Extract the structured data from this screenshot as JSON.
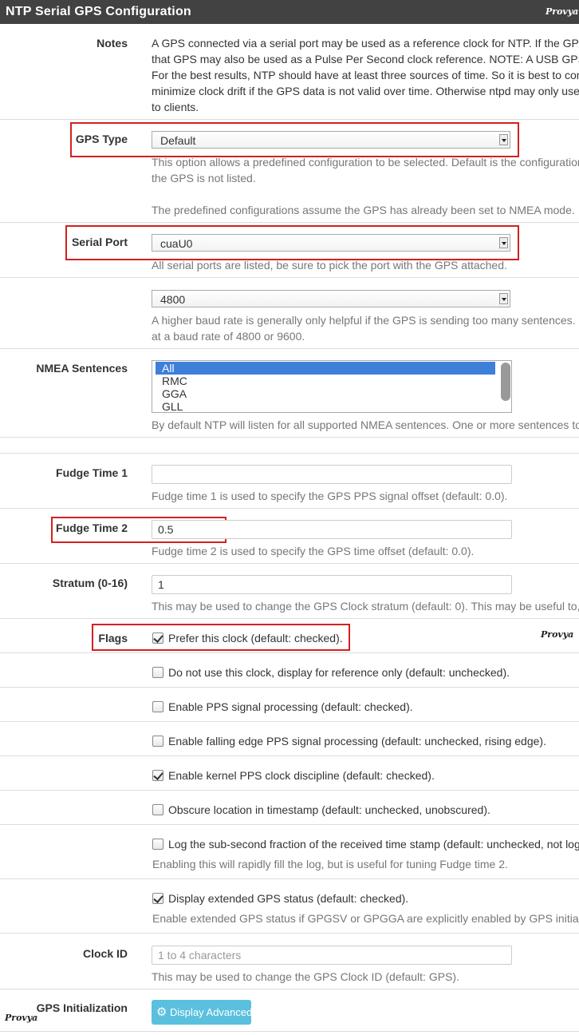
{
  "header": {
    "title": "NTP Serial GPS Configuration",
    "logo": "Provya"
  },
  "notes": {
    "label": "Notes",
    "lines": [
      "A GPS connected via a serial port may be used as a reference clock for NTP. If the GPS a",
      "that GPS may also be used as a Pulse Per Second clock reference. NOTE: A USB GPS ma",
      "For the best results, NTP should have at least three sources of time. So it is best to conf",
      "minimize clock drift if the GPS data is not valid over time. Otherwise ntpd may only use v",
      "to clients."
    ]
  },
  "gps_type": {
    "label": "GPS Type",
    "value": "Default",
    "help1a": "This option allows a predefined configuration to be selected. Default is the configuration",
    "help1b": "the GPS is not listed.",
    "help2": "The predefined configurations assume the GPS has already been set to NMEA mode."
  },
  "serial_port": {
    "label": "Serial Port",
    "value": "cuaU0",
    "help": "All serial ports are listed, be sure to pick the port with the GPS attached."
  },
  "baud": {
    "value": "4800",
    "help1": "A higher baud rate is generally only helpful if the GPS is sending too many sentences. It",
    "help2": "at a baud rate of 4800 or 9600."
  },
  "nmea": {
    "label": "NMEA Sentences",
    "options": [
      "All",
      "RMC",
      "GGA",
      "GLL"
    ],
    "help": "By default NTP will listen for all supported NMEA sentences. One or more sentences to l"
  },
  "fudge1": {
    "label": "Fudge Time 1",
    "value": "",
    "help": "Fudge time 1 is used to specify the GPS PPS signal offset (default: 0.0)."
  },
  "fudge2": {
    "label": "Fudge Time 2",
    "value": "0.5",
    "help": "Fudge time 2 is used to specify the GPS time offset (default: 0.0)."
  },
  "stratum": {
    "label": "Stratum (0-16)",
    "value": "1",
    "help": "This may be used to change the GPS Clock stratum (default: 0). This may be useful to, f"
  },
  "flags": {
    "label": "Flags",
    "items": [
      {
        "text": "Prefer this clock (default: checked).",
        "checked": true
      },
      {
        "text": "Do not use this clock, display for reference only (default: unchecked).",
        "checked": false
      },
      {
        "text": "Enable PPS signal processing (default: checked).",
        "checked": false
      },
      {
        "text": "Enable falling edge PPS signal processing (default: unchecked, rising edge).",
        "checked": false
      },
      {
        "text": "Enable kernel PPS clock discipline (default: checked).",
        "checked": true
      },
      {
        "text": "Obscure location in timestamp (default: unchecked, unobscured).",
        "checked": false
      },
      {
        "text": "Log the sub-second fraction of the received time stamp (default: unchecked, not log",
        "checked": false
      },
      {
        "text": "Display extended GPS status (default: checked).",
        "checked": true
      }
    ],
    "help_log": "Enabling this will rapidly fill the log, but is useful for tuning Fudge time 2.",
    "help_ext": "Enable extended GPS status if GPGSV or GPGGA are explicitly enabled by GPS initializa"
  },
  "clock_id": {
    "label": "Clock ID",
    "placeholder": "1 to 4 characters",
    "help": "This may be used to change the GPS Clock ID (default: GPS)."
  },
  "gps_init": {
    "label": "GPS Initialization",
    "button": "Display Advanced"
  },
  "colors": {
    "header_bg": "#424242",
    "highlight": "#d32020",
    "button": "#5bc0de",
    "selection": "#3e7fd9"
  }
}
